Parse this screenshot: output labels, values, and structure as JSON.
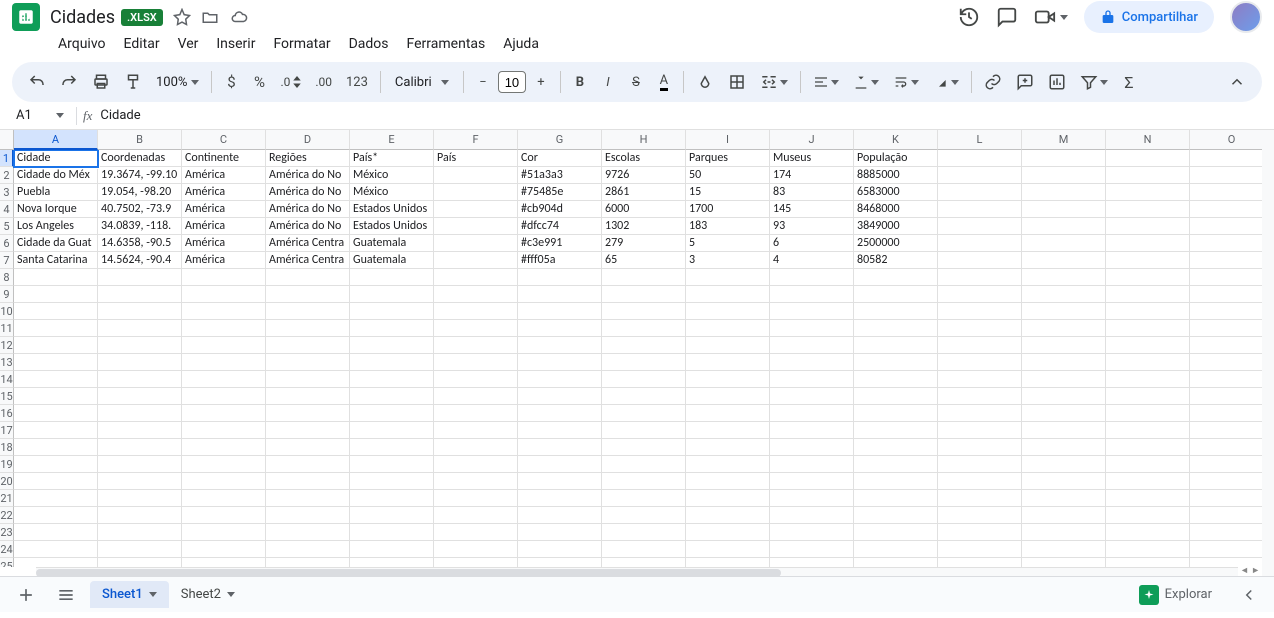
{
  "doc": {
    "title": "Cidades",
    "badge": ".XLSX"
  },
  "menus": [
    "Arquivo",
    "Editar",
    "Ver",
    "Inserir",
    "Formatar",
    "Dados",
    "Ferramentas",
    "Ajuda"
  ],
  "toolbar": {
    "zoom": "100%",
    "font": "Calibri",
    "font_size": "10",
    "fmt123": "123"
  },
  "share_label": "Compartilhar",
  "cell_ref": "A1",
  "formula_value": "Cidade",
  "columns": [
    "A",
    "B",
    "C",
    "D",
    "E",
    "F",
    "G",
    "H",
    "I",
    "J",
    "K",
    "L",
    "M",
    "N",
    "O"
  ],
  "selected_col": "A",
  "selected_row": 1,
  "row_count": 26,
  "data_rows": [
    [
      "Cidade",
      "Coordenadas",
      "Continente",
      "Regiões",
      "País*",
      "País",
      "Cor",
      "Escolas",
      "Parques",
      "Museus",
      "População",
      "",
      "",
      "",
      ""
    ],
    [
      "Cidade do Méx",
      "19.3674, -99.10",
      "América",
      "América do No",
      "México",
      "",
      "#51a3a3",
      "9726",
      "50",
      "174",
      "8885000",
      "",
      "",
      "",
      ""
    ],
    [
      "Puebla",
      "19.054, -98.20",
      "América",
      "América do No",
      "México",
      "",
      "#75485e",
      "2861",
      "15",
      "83",
      "6583000",
      "",
      "",
      "",
      ""
    ],
    [
      "Nova Iorque",
      "40.7502, -73.9",
      "América",
      "América do No",
      "Estados Unidos",
      "",
      "#cb904d",
      "6000",
      "1700",
      "145",
      "8468000",
      "",
      "",
      "",
      ""
    ],
    [
      "Los Angeles",
      "34.0839, -118.",
      "América",
      "América do No",
      "Estados Unidos",
      "",
      "#dfcc74",
      "1302",
      "183",
      "93",
      "3849000",
      "",
      "",
      "",
      ""
    ],
    [
      "Cidade da Guat",
      "14.6358, -90.5",
      "América",
      "América Centra",
      "Guatemala",
      "",
      "#c3e991",
      "279",
      "5",
      "6",
      "2500000",
      "",
      "",
      "",
      ""
    ],
    [
      "Santa Catarina",
      "14.5624, -90.4",
      "América",
      "América Centra",
      "Guatemala",
      "",
      "#fff05a",
      "65",
      "3",
      "4",
      "80582",
      "",
      "",
      "",
      ""
    ]
  ],
  "sheets": [
    {
      "name": "Sheet1",
      "active": true
    },
    {
      "name": "Sheet2",
      "active": false
    }
  ],
  "explore_label": "Explorar"
}
